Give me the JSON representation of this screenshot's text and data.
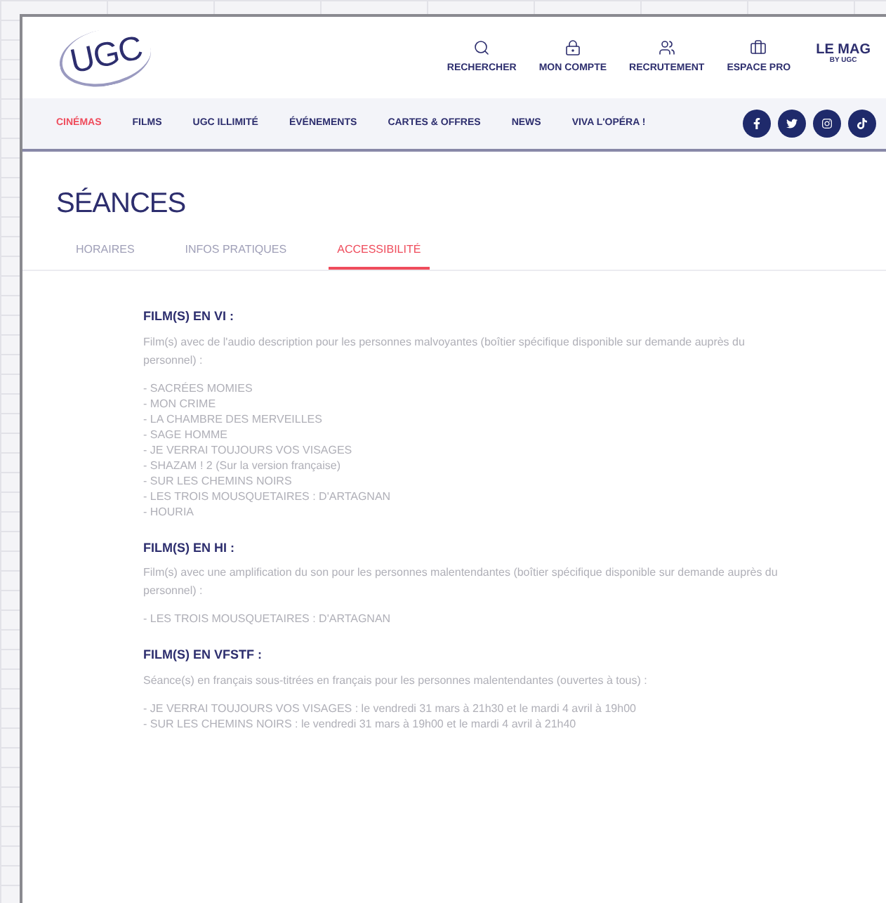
{
  "header": {
    "logo": "UGC",
    "actions": [
      {
        "kind": "search",
        "label": "RECHERCHER"
      },
      {
        "kind": "account",
        "label": "MON COMPTE"
      },
      {
        "kind": "jobs",
        "label": "RECRUTEMENT"
      },
      {
        "kind": "pro",
        "label": "ESPACE PRO"
      }
    ],
    "mag": {
      "title": "LE MAG",
      "subtitle": "BY UGC"
    }
  },
  "nav": [
    {
      "label": "CINÉMAS",
      "selected": true
    },
    {
      "label": "FILMS",
      "selected": false
    },
    {
      "label": "UGC ILLIMITÉ",
      "selected": false
    },
    {
      "label": "ÉVÉNEMENTS",
      "selected": false
    },
    {
      "label": "CARTES & OFFRES",
      "selected": false
    },
    {
      "label": "NEWS",
      "selected": false
    },
    {
      "label": "VIVA L'OPÉRA !",
      "selected": false
    }
  ],
  "social": [
    {
      "kind": "facebook"
    },
    {
      "kind": "twitter"
    },
    {
      "kind": "instagram"
    },
    {
      "kind": "tiktok"
    }
  ],
  "page_title": "SÉANCES",
  "tabs": [
    {
      "label": "HORAIRES",
      "selected": false
    },
    {
      "label": "INFOS PRATIQUES",
      "selected": false
    },
    {
      "label": "ACCESSIBILITÉ",
      "selected": true
    }
  ],
  "sections": [
    {
      "title": "FILM(S) EN VI :",
      "description": "Film(s) avec de l'audio description pour les personnes malvoyantes (boîtier spécifique disponible sur demande auprès du personnel) :",
      "items": [
        "- SACRÉES MOMIES",
        "- MON CRIME",
        "- LA CHAMBRE DES MERVEILLES",
        "- SAGE HOMME",
        "- JE VERRAI TOUJOURS VOS VISAGES",
        "- SHAZAM ! 2 (Sur la version française)",
        "- SUR LES CHEMINS NOIRS",
        "- LES TROIS MOUSQUETAIRES : D'ARTAGNAN",
        "- HOURIA"
      ]
    },
    {
      "title": "FILM(S) EN HI :",
      "description": "Film(s) avec une amplification du son pour les personnes malentendantes (boîtier spécifique disponible sur demande auprès du personnel) :",
      "items": [
        "- LES TROIS MOUSQUETAIRES : D'ARTAGNAN"
      ]
    },
    {
      "title": "FILM(S) EN VFSTF :",
      "description": "Séance(s) en français sous-titrées en français pour les personnes malentendantes (ouvertes à tous) :",
      "items": [
        "- JE VERRAI TOUJOURS VOS VISAGES : le vendredi 31 mars à 21h30 et le mardi 4 avril à 19h00",
        "- SUR LES CHEMINS NOIRS : le vendredi 31 mars à 19h00 et le mardi 4 avril à 21h40"
      ]
    }
  ]
}
